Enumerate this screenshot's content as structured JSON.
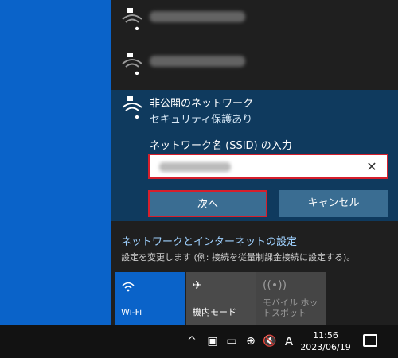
{
  "network_list": {
    "hidden_network": {
      "title": "非公開のネットワーク",
      "security": "セキュリティ保護あり",
      "ssid_label": "ネットワーク名 (SSID) の入力",
      "next_button": "次へ",
      "cancel_button": "キャンセル"
    }
  },
  "settings": {
    "title": "ネットワークとインターネットの設定",
    "subtitle": "設定を変更します (例: 接続を従量制課金接続に設定する)。"
  },
  "quick_actions": {
    "wifi": "Wi-Fi",
    "airplane": "機内モード",
    "hotspot": "モバイル ホットスポット"
  },
  "taskbar": {
    "ime": "A",
    "time": "11:56",
    "date": "2023/06/19"
  },
  "colors": {
    "accent": "#0a63c9",
    "panel": "#1f1f1f",
    "selected_item": "#0f3a5e",
    "highlight_border": "#d61f2c"
  }
}
